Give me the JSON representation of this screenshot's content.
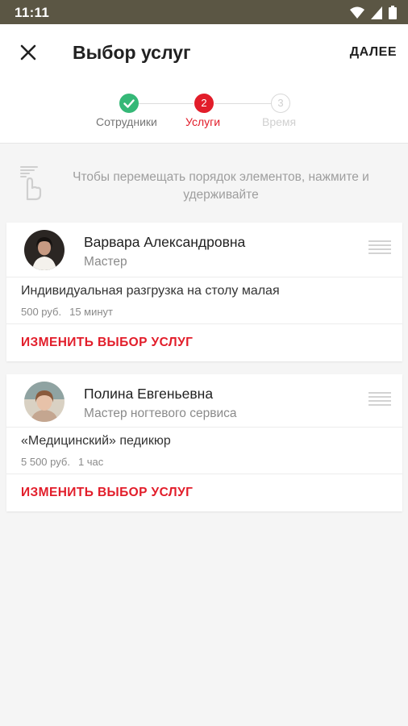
{
  "status_bar": {
    "time": "11:11"
  },
  "app_bar": {
    "title": "Выбор услуг",
    "next_label": "ДАЛЕЕ"
  },
  "stepper": {
    "steps": [
      {
        "label": "Сотрудники",
        "number": "",
        "state": "done"
      },
      {
        "label": "Услуги",
        "number": "2",
        "state": "active"
      },
      {
        "label": "Время",
        "number": "3",
        "state": "inactive"
      }
    ]
  },
  "hint": {
    "text": "Чтобы перемещать порядок элементов, нажмите и удерживайте"
  },
  "cards": [
    {
      "employee_name": "Варвара Александровна",
      "employee_role": "Мастер",
      "service_name": "Индивидуальная разгрузка на столу малая",
      "price": "500 руб.",
      "duration": "15 минут",
      "change_label": "ИЗМЕНИТЬ ВЫБОР УСЛУГ"
    },
    {
      "employee_name": "Полина Евгеньевна",
      "employee_role": "Мастер ногтевого сервиса",
      "service_name": "«Медицинский» педикюр",
      "price": "5 500 руб.",
      "duration": "1 час",
      "change_label": "ИЗМЕНИТЬ ВЫБОР УСЛУГ"
    }
  ],
  "colors": {
    "accent": "#e21d2a",
    "done": "#35b877",
    "status_bar": "#5b5644"
  },
  "icons": [
    "wifi-icon",
    "signal-icon",
    "battery-icon",
    "close-icon",
    "check-icon",
    "touch-hold-icon",
    "drag-handle-icon"
  ]
}
